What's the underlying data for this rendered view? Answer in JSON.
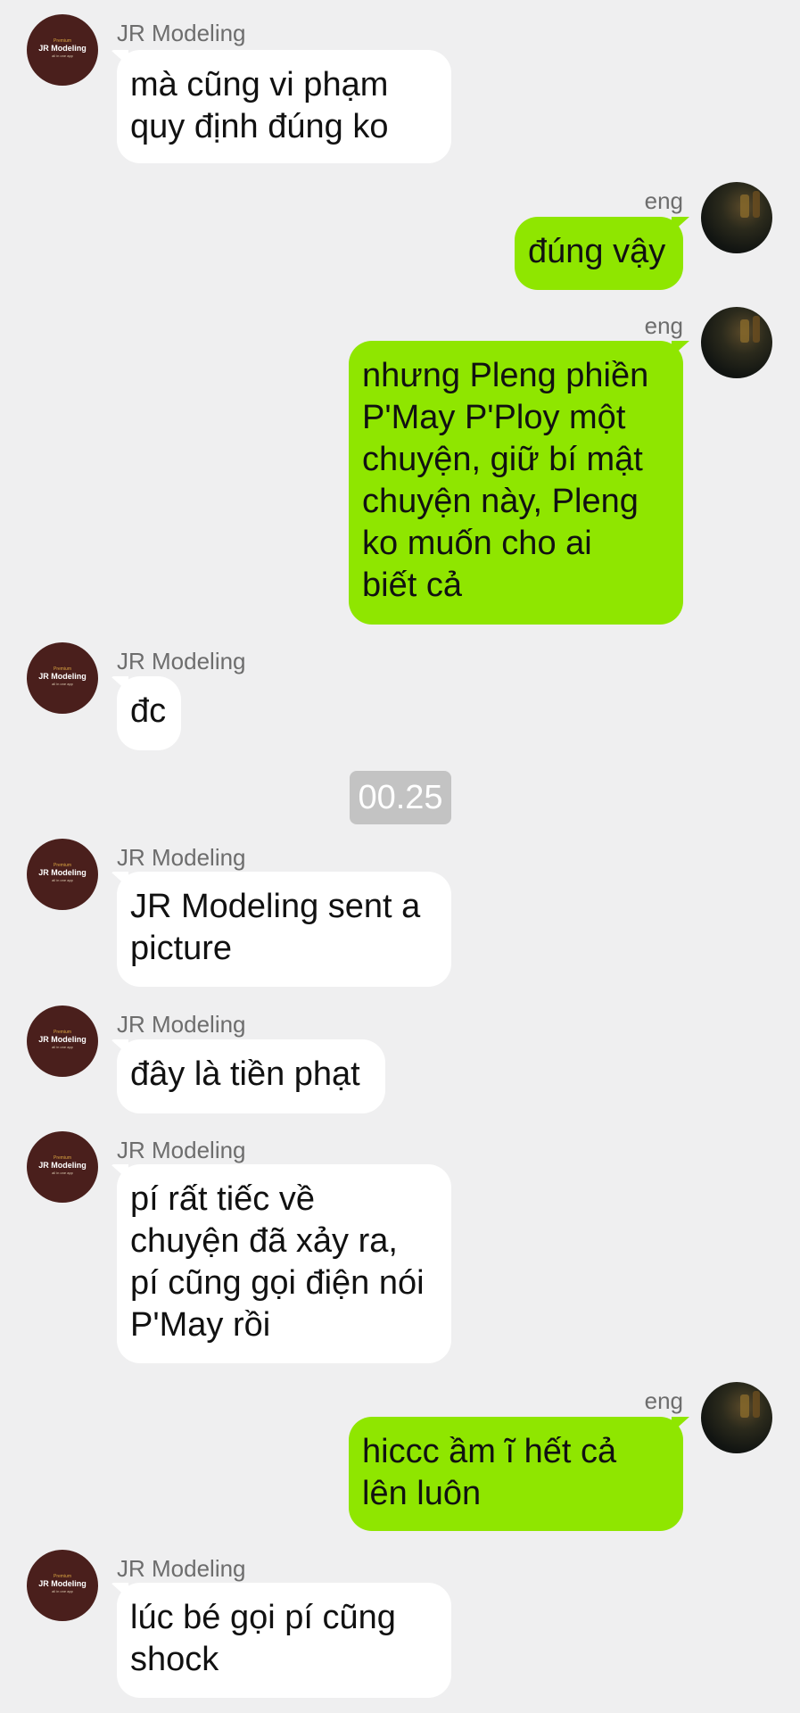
{
  "contacts": {
    "them": {
      "name": "JR Modeling",
      "avatar_text": [
        "Premium",
        "JR Modeling",
        "all in one app"
      ]
    },
    "me": {
      "name": "eng"
    }
  },
  "timestamp": "00.25",
  "messages": [
    {
      "text": "mà cũng vi phạm\nquy định đúng ko"
    },
    {
      "text": "đúng vậy"
    },
    {
      "text": "nhưng Pleng phiền\nP'May P'Ploy một\nchuyện, giữ bí mật\nchuyện này, Pleng\nko muốn cho ai\nbiết cả"
    },
    {
      "text": "đc"
    },
    {
      "text": "JR Modeling sent a\npicture"
    },
    {
      "text": "đây là tiền phạt"
    },
    {
      "text": "pí rất tiếc về\nchuyện đã xảy ra,\npí cũng gọi điện nói\nP'May rồi"
    },
    {
      "text": "hiccc ầm ĩ hết cả\nlên luôn"
    },
    {
      "text": "lúc bé gọi pí cũng\nshock"
    }
  ]
}
